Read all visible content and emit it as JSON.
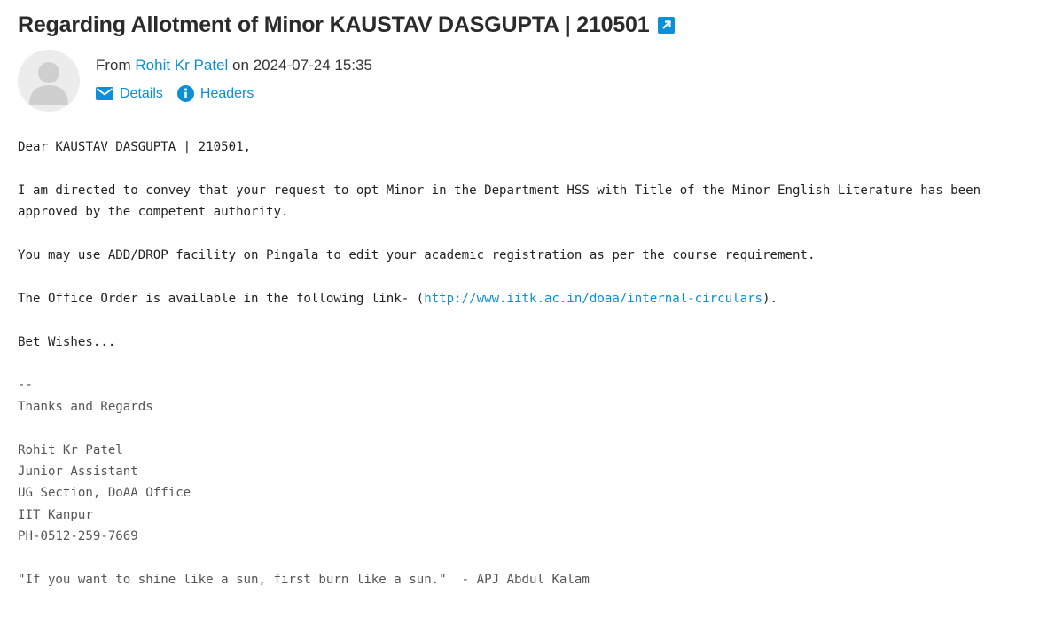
{
  "subject": "Regarding Allotment of Minor KAUSTAV DASGUPTA | 210501",
  "header": {
    "from_prefix": "From",
    "sender": "Rohit Kr Patel",
    "on_word": "on",
    "date": "2024-07-24 15:35",
    "details_label": "Details",
    "headers_label": "Headers"
  },
  "icons": {
    "popout": "external-link-icon",
    "avatar": "user-avatar-icon",
    "details": "envelope-icon",
    "headers": "info-icon"
  },
  "colors": {
    "accent": "#0b8fd6"
  },
  "message": {
    "greeting": "Dear KAUSTAV DASGUPTA | 210501,",
    "para1": "I am directed to convey that your request to opt Minor in the Department HSS with Title of the Minor English Literature has been approved by the competent authority.",
    "para2": "You may use ADD/DROP facility on Pingala to edit your academic registration as per the course requirement.",
    "para3_before": "The Office Order is available in the following link- (",
    "para3_link": "http://www.iitk.ac.in/doaa/internal-circulars",
    "para3_after": ").",
    "closing": "Bet Wishes..."
  },
  "signature": {
    "separator": "--",
    "regards": "Thanks and Regards",
    "name": "Rohit Kr Patel",
    "title": "Junior Assistant",
    "section": "UG Section, DoAA Office",
    "institute": "IIT Kanpur",
    "phone": "PH-0512-259-7669",
    "quote": "\"If you want to shine like a sun, first burn like a sun.\"  - APJ Abdul Kalam"
  }
}
